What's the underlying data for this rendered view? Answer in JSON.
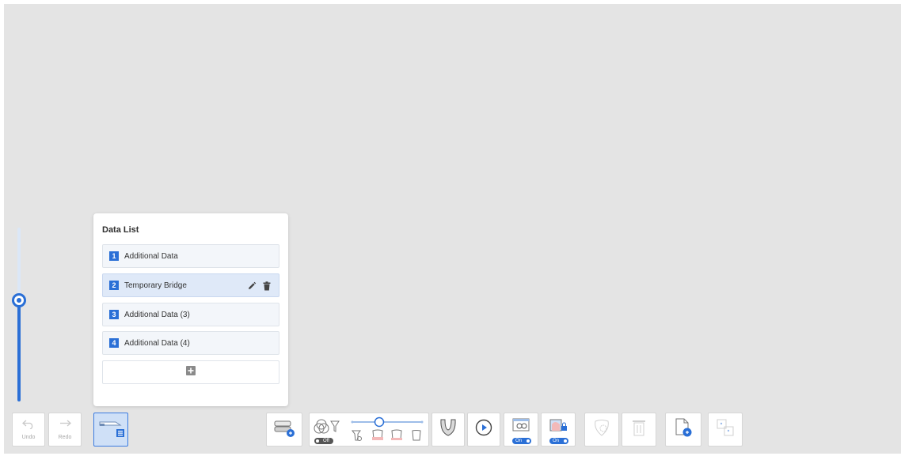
{
  "data_list": {
    "title": "Data List",
    "items": [
      {
        "number": "1",
        "label": "Additional Data"
      },
      {
        "number": "2",
        "label": "Temporary Bridge"
      },
      {
        "number": "3",
        "label": "Additional Data (3)"
      },
      {
        "number": "4",
        "label": "Additional Data (4)"
      }
    ],
    "selected_index": 1
  },
  "toolbar": {
    "undo_label": "Undo",
    "redo_label": "Redo",
    "visibility_toggle": "Off",
    "camera_toggle": "On",
    "lock_toggle": "On"
  },
  "colors": {
    "accent": "#2a6fd6",
    "background": "#e4e4e4",
    "selected_row": "#dfe9f8"
  },
  "slider": {
    "level": 0.58
  }
}
